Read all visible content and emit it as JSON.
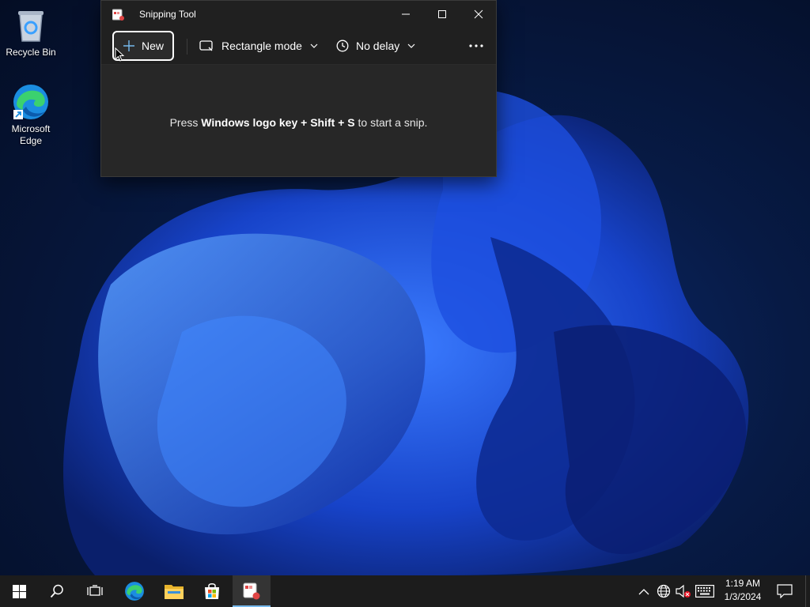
{
  "desktop": {
    "icons": [
      {
        "label": "Recycle Bin"
      },
      {
        "label": "Microsoft Edge"
      }
    ]
  },
  "snipping_tool": {
    "title": "Snipping Tool",
    "new_label": "New",
    "mode_label": "Rectangle mode",
    "delay_label": "No delay",
    "hint_prefix": "Press ",
    "hint_bold": "Windows logo key + Shift + S",
    "hint_suffix": " to start a snip."
  },
  "taskbar": {
    "apps": [
      "start-icon",
      "search-icon",
      "task-view-icon",
      "edge-icon",
      "file-explorer-icon",
      "store-icon",
      "snipping-tool-icon"
    ],
    "active_app": "snipping-tool-icon",
    "time": "1:19 AM",
    "date": "1/3/2024"
  },
  "colors": {
    "accent": "#76b9ed",
    "window_bg": "#202020",
    "taskbar_bg": "#1c1c1c"
  }
}
